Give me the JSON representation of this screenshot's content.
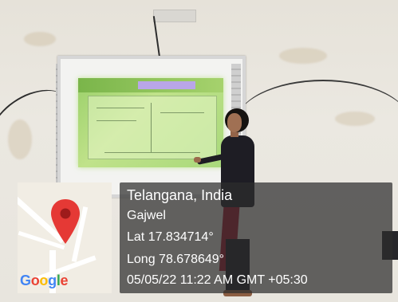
{
  "location": {
    "title": "Telangana, India",
    "city": "Gajwel",
    "lat": "Lat 17.834714°",
    "long": "Long 78.678649°",
    "timestamp": "05/05/22 11:22 AM GMT +05:30"
  },
  "map": {
    "logo_text": "Google",
    "pin_icon": "map-pin-icon",
    "pin_color": "#E53935"
  },
  "colors": {
    "overlay_bg": "#2d2d2d",
    "projection_green": "#a9d97b"
  }
}
